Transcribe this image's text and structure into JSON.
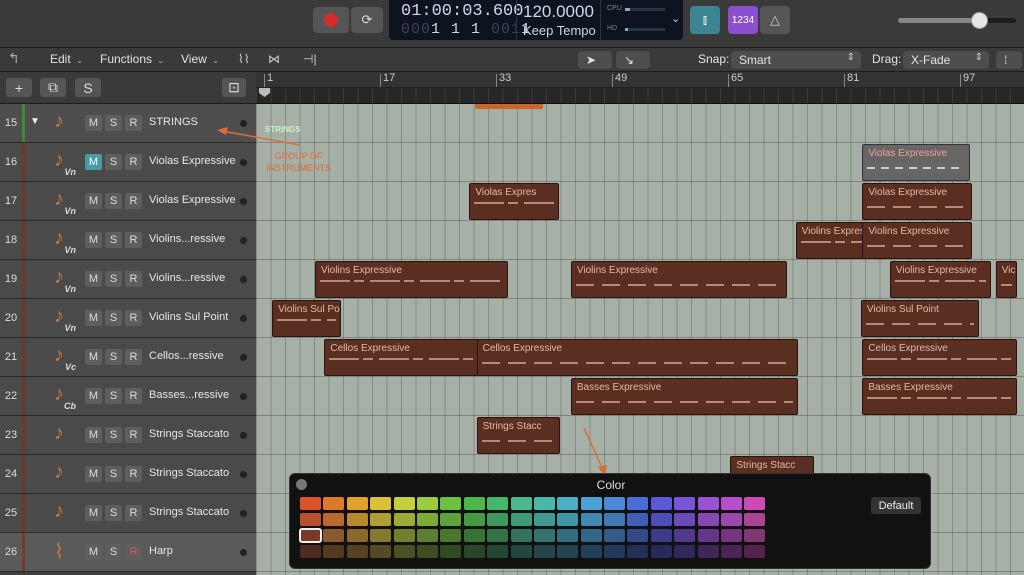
{
  "transport": {
    "position": "01:00:03.600",
    "bars_main": "1  1  1",
    "bars_dim_a": "000",
    "bars_dim_b": "001",
    "bars_last": "1",
    "tempo": "120.0000",
    "tempo_mode": "Keep Tempo",
    "cpu_label": "CPU",
    "hd_label": "HD",
    "count_in_label": "1234",
    "colors": {
      "record": "#d42a2a",
      "mixer": "#3d8592",
      "count_in": "#8b4fd0"
    }
  },
  "menu": {
    "edit": "Edit",
    "functions": "Functions",
    "view": "View",
    "snap_label": "Snap:",
    "snap_value": "Smart",
    "drag_label": "Drag:",
    "drag_value": "X-Fade"
  },
  "track_tools": {
    "add": "+",
    "solo": "S"
  },
  "ruler": [
    "1",
    "17",
    "33",
    "49",
    "65",
    "81",
    "97"
  ],
  "tracks": [
    {
      "num": "15",
      "name": "STRINGS",
      "sub": "",
      "color": "#3b8a3b",
      "folder": true,
      "m_on": false,
      "r_rec": false
    },
    {
      "num": "16",
      "name": "Violas Expressive",
      "sub": "Vn",
      "color": "#6e3a28",
      "folder": false,
      "m_on": true,
      "r_rec": false
    },
    {
      "num": "17",
      "name": "Violas Expressive",
      "sub": "Vn",
      "color": "#6e3a28",
      "folder": false,
      "m_on": false,
      "r_rec": false
    },
    {
      "num": "18",
      "name": "Violins...ressive",
      "sub": "Vn",
      "color": "#6e3a28",
      "folder": false,
      "m_on": false,
      "r_rec": false
    },
    {
      "num": "19",
      "name": "Violins...ressive",
      "sub": "Vn",
      "color": "#6e3a28",
      "folder": false,
      "m_on": false,
      "r_rec": false
    },
    {
      "num": "20",
      "name": "Violins Sul Point",
      "sub": "Vn",
      "color": "#6e3a28",
      "folder": false,
      "m_on": false,
      "r_rec": false
    },
    {
      "num": "21",
      "name": "Cellos...ressive",
      "sub": "Vc",
      "color": "#6e3a28",
      "folder": false,
      "m_on": false,
      "r_rec": false
    },
    {
      "num": "22",
      "name": "Basses...ressive",
      "sub": "Cb",
      "color": "#6e3a28",
      "folder": false,
      "m_on": false,
      "r_rec": false
    },
    {
      "num": "23",
      "name": "Strings Staccato",
      "sub": "",
      "color": "#6e3a28",
      "folder": false,
      "m_on": false,
      "r_rec": false
    },
    {
      "num": "24",
      "name": "Strings Staccato",
      "sub": "",
      "color": "#6e3a28",
      "folder": false,
      "m_on": false,
      "r_rec": false
    },
    {
      "num": "25",
      "name": "Strings Staccato",
      "sub": "",
      "color": "#6e3a28",
      "folder": false,
      "m_on": false,
      "r_rec": false
    },
    {
      "num": "26",
      "name": "Harp",
      "sub": "",
      "color": "#7a3a28",
      "folder": false,
      "m_on": false,
      "r_rec": true
    }
  ],
  "regions": [
    {
      "row": 1,
      "name": "Violas Expressive",
      "start": 82.7,
      "end": 97.5,
      "grey": true
    },
    {
      "row": 2,
      "name": "Violas Expres",
      "start": 28.5,
      "end": 40.8,
      "grey": false
    },
    {
      "row": 2,
      "name": "Violas Expressive",
      "start": 82.7,
      "end": 97.8,
      "grey": false
    },
    {
      "row": 3,
      "name": "Violins Expressive",
      "start": 73.5,
      "end": 91.5,
      "grey": false
    },
    {
      "row": 3,
      "name": "Violins Expressive",
      "start": 82.7,
      "end": 97.8,
      "grey": false
    },
    {
      "row": 4,
      "name": "Violins Expressive",
      "start": 7.2,
      "end": 33.8,
      "grey": false
    },
    {
      "row": 4,
      "name": "Violins Expressive",
      "start": 42.5,
      "end": 72.3,
      "grey": false
    },
    {
      "row": 4,
      "name": "Violins Expressive",
      "start": 86.5,
      "end": 100.5,
      "grey": false
    },
    {
      "row": 4,
      "name": "Vic",
      "start": 101.1,
      "end": 104.0,
      "grey": false
    },
    {
      "row": 5,
      "name": "Violins Sul Po",
      "start": 1.3,
      "end": 10.8,
      "grey": false
    },
    {
      "row": 5,
      "name": "Violins Sul Point",
      "start": 82.5,
      "end": 98.8,
      "grey": false
    },
    {
      "row": 6,
      "name": "Cellos Expressive",
      "start": 8.5,
      "end": 34.2,
      "grey": false
    },
    {
      "row": 6,
      "name": "Cellos Expressive",
      "start": 29.5,
      "end": 73.8,
      "grey": false
    },
    {
      "row": 6,
      "name": "Cellos Expressive",
      "start": 82.7,
      "end": 104.0,
      "grey": false
    },
    {
      "row": 7,
      "name": "Basses Expressive",
      "start": 42.5,
      "end": 73.8,
      "grey": false
    },
    {
      "row": 7,
      "name": "Basses Expressive",
      "start": 82.7,
      "end": 104.0,
      "grey": false
    },
    {
      "row": 8,
      "name": "Strings Stacc",
      "start": 29.5,
      "end": 41.0,
      "grey": false
    },
    {
      "row": 9,
      "name": "Strings Stacc",
      "start": 64.5,
      "end": 76.0,
      "grey": false
    }
  ],
  "annotations": {
    "strings_label": "STRINGS",
    "group_note_line1": "GROUP OF",
    "group_note_line2": "INSTRUMENTS",
    "arrow_color": "#e06a3a"
  },
  "color_picker": {
    "title": "Color",
    "default_label": "Default",
    "selected": {
      "row": 2,
      "col": 0
    },
    "rows": [
      [
        "#d9532c",
        "#dd7a2a",
        "#e0a22c",
        "#d9c23a",
        "#c4cf3c",
        "#9ccc3c",
        "#6cc23e",
        "#4cb84a",
        "#45b769",
        "#4ab88c",
        "#4bb7ab",
        "#4bb0c4",
        "#4aa2d4",
        "#4a8ad8",
        "#4a6ed8",
        "#5a5ad8",
        "#7a55d8",
        "#9a52d4",
        "#b84ecc",
        "#cc4ab4"
      ],
      [
        "#b8502e",
        "#b86a2e",
        "#b88a30",
        "#b0a034",
        "#9cac36",
        "#80aa38",
        "#5ea23a",
        "#469a44",
        "#3e9a5c",
        "#409a78",
        "#409a92",
        "#4096a6",
        "#408ab2",
        "#4078b6",
        "#405eb6",
        "#4e4eb6",
        "#6a4ab6",
        "#844ab2",
        "#9c48aa",
        "#ac4496"
      ],
      [
        "#7a3a28",
        "#8a5a2c",
        "#8a6a2c",
        "#847a30",
        "#74802e",
        "#5e7e30",
        "#48782e",
        "#3a7236",
        "#347248",
        "#34725e",
        "#347270",
        "#346e7e",
        "#346686",
        "#345a8a",
        "#34488a",
        "#3c3c8a",
        "#50388a",
        "#643886",
        "#743680",
        "#803670"
      ],
      [
        "#4e2a20",
        "#54391f",
        "#564221",
        "#524a22",
        "#4a5022",
        "#3e4e22",
        "#304a22",
        "#284628",
        "#244634",
        "#244640",
        "#24464a",
        "#244452",
        "#244058",
        "#24385a",
        "#242e5a",
        "#28285a",
        "#34265a",
        "#402658",
        "#4a2454",
        "#52244a"
      ]
    ]
  }
}
